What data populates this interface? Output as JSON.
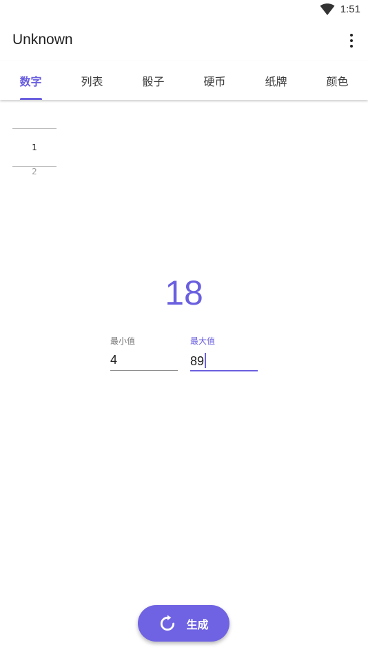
{
  "status_bar": {
    "time": "1:51",
    "wifi_icon": "wifi-icon"
  },
  "app_bar": {
    "title": "Unknown",
    "menu_icon": "more-vert-icon"
  },
  "tabs": [
    {
      "label": "数字",
      "active": true
    },
    {
      "label": "列表",
      "active": false
    },
    {
      "label": "骰子",
      "active": false
    },
    {
      "label": "硬币",
      "active": false
    },
    {
      "label": "纸牌",
      "active": false
    },
    {
      "label": "颜色",
      "active": false
    }
  ],
  "picker": {
    "current": "1",
    "next": "2"
  },
  "result": "18",
  "fields": {
    "min": {
      "label": "最小值",
      "value": "4"
    },
    "max": {
      "label": "最大值",
      "value": "89"
    }
  },
  "generate_button": {
    "label": "生成",
    "icon": "refresh-icon"
  },
  "colors": {
    "accent": "#6a5fdf",
    "button": "#6f63e3"
  }
}
